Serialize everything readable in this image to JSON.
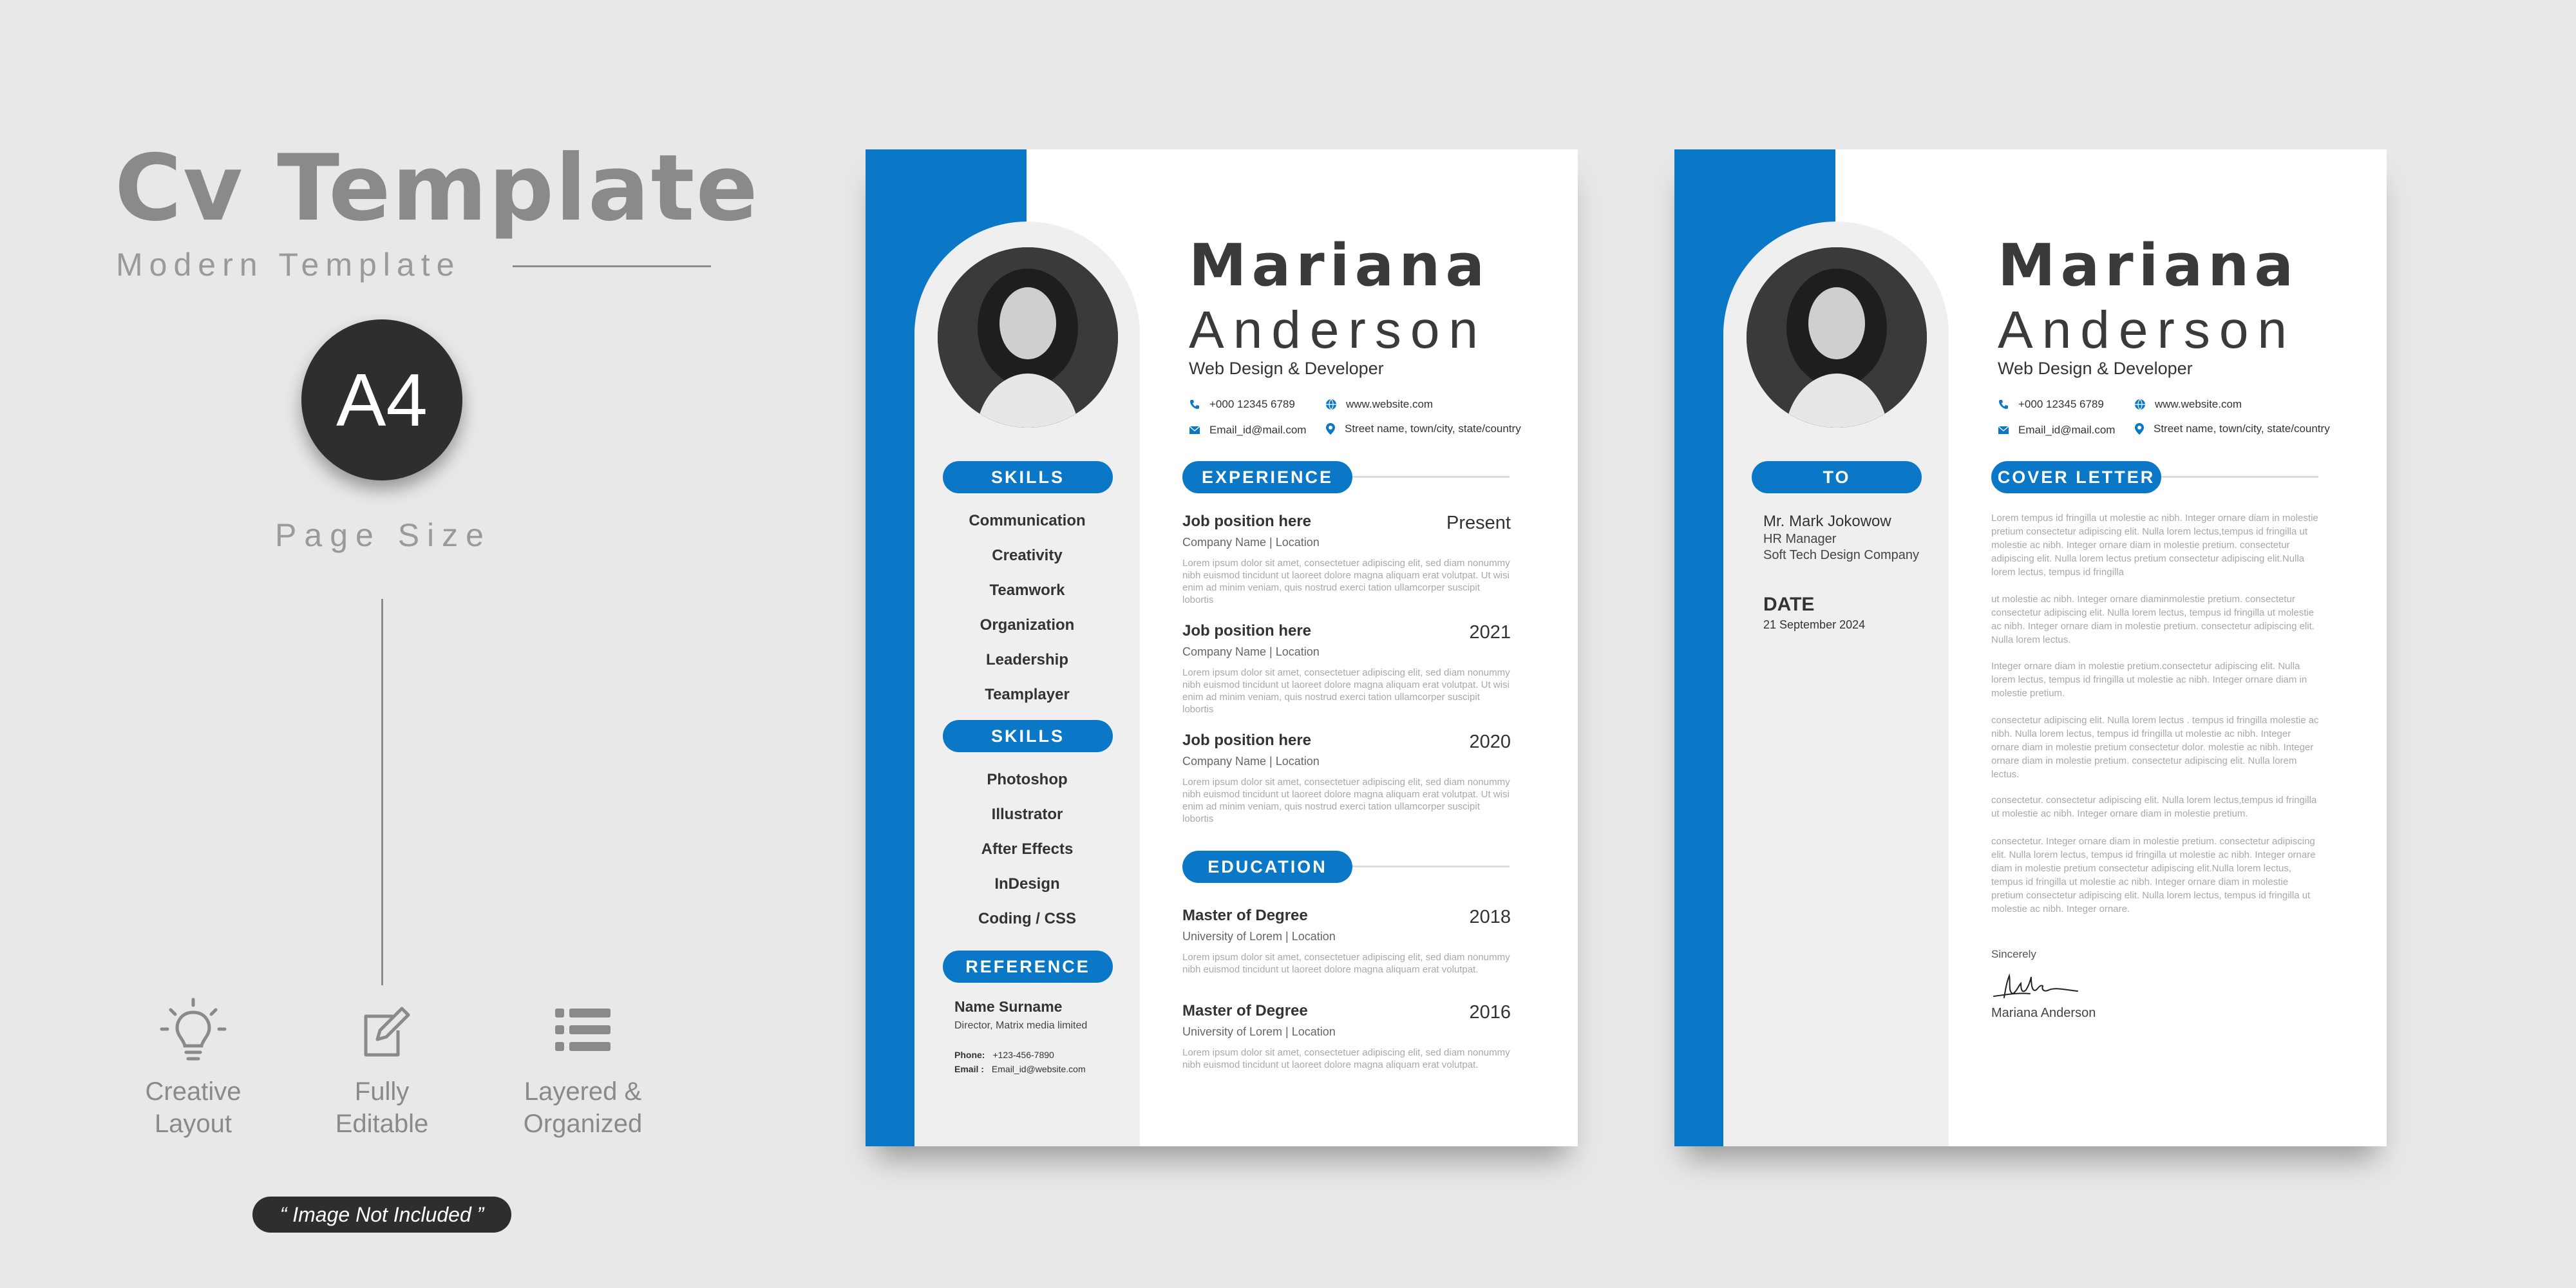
{
  "promo": {
    "title": "Cv Template",
    "subtitle": "Modern Template",
    "badge": "A4",
    "page_size": "Page Size",
    "features": [
      {
        "icon": "lightbulb-icon",
        "line1": "Creative",
        "line2": "Layout"
      },
      {
        "icon": "edit-icon",
        "line1": "Fully",
        "line2": "Editable"
      },
      {
        "icon": "layers-list-icon",
        "line1": "Layered &",
        "line2": "Organized"
      }
    ],
    "note": "“ Image Not Included ”"
  },
  "cv": {
    "first_name": "Mariana",
    "last_name": "Anderson",
    "role": "Web Design & Developer",
    "phone": "+000 12345 6789",
    "website": "www.website.com",
    "email": "Email_id@mail.com",
    "address": "Street name, town/city, state/country",
    "skills_label": "SKILLS",
    "skills": [
      "Communication",
      "Creativity",
      "Teamwork",
      "Organization",
      "Leadership",
      "Teamplayer"
    ],
    "skills2_label": "SKILLS",
    "software": [
      "Photoshop",
      "Illustrator",
      "After Effects",
      "InDesign",
      "Coding / CSS"
    ],
    "reference_label": "REFERENCE",
    "reference": {
      "name": "Name Surname",
      "role": "Director, Matrix media limited",
      "phone_label": "Phone:",
      "phone": "+123-456-7890",
      "email_label": "Email :",
      "email": "Email_id@website.com"
    },
    "experience_label": "EXPERIENCE",
    "experience": [
      {
        "title": "Job position here",
        "year": "Present",
        "company": "Company Name  |  Location",
        "desc": "Lorem ipsum dolor sit amet, consectetuer adipiscing elit, sed diam nonummy nibh euismod tincidunt ut laoreet dolore magna aliquam erat volutpat. Ut wisi enim ad minim veniam, quis nostrud exerci tation ullamcorper suscipit lobortis"
      },
      {
        "title": "Job position here",
        "year": "2021",
        "company": "Company Name  |  Location",
        "desc": "Lorem ipsum dolor sit amet, consectetuer adipiscing elit, sed diam nonummy nibh euismod tincidunt ut laoreet dolore magna aliquam erat volutpat. Ut wisi enim ad minim veniam, quis nostrud exerci tation ullamcorper suscipit lobortis"
      },
      {
        "title": "Job position here",
        "year": "2020",
        "company": "Company Name  |  Location",
        "desc": "Lorem ipsum dolor sit amet, consectetuer adipiscing elit, sed diam nonummy nibh euismod tincidunt ut laoreet dolore magna aliquam erat volutpat. Ut wisi enim ad minim veniam, quis nostrud exerci tation ullamcorper suscipit lobortis"
      }
    ],
    "education_label": "EDUCATION",
    "education": [
      {
        "title": "Master of Degree",
        "year": "2018",
        "company": "University of Lorem  |  Location",
        "desc": "Lorem ipsum dolor sit amet, consectetuer adipiscing elit, sed diam nonummy nibh euismod tincidunt ut laoreet dolore magna aliquam erat volutpat."
      },
      {
        "title": "Master of Degree",
        "year": "2016",
        "company": "University of Lorem  |  Location",
        "desc": "Lorem ipsum dolor sit amet, consectetuer adipiscing elit, sed diam nonummy nibh euismod tincidunt ut laoreet dolore magna aliquam erat volutpat."
      }
    ]
  },
  "cover": {
    "to_label": "TO",
    "to_name": "Mr. Mark Jokowow",
    "to_title": "HR Manager",
    "to_company": "Soft Tech Design Company",
    "date_label": "DATE",
    "date_value": "21 September 2024",
    "letter_label": "COVER LETTER",
    "paragraphs": [
      "Lorem tempus id fringilla ut molestie ac nibh. Integer ornare diam in molestie pretium consectetur adipiscing elit. Nulla lorem lectus,tempus id fringilla ut molestie ac nibh. Integer ornare diam in molestie pretium. consectetur adipiscing elit. Nulla lorem lectus pretium consectetur adipiscing elit.Nulla lorem lectus, tempus id fringilla",
      " ut molestie ac nibh. Integer ornare diaminmolestie pretium. consectetur consectetur adipiscing elit. Nulla lorem lectus, tempus id fringilla ut molestie ac nibh. Integer ornare diam in molestie   pretium.  consectetur adipiscing elit. Nulla lorem lectus.",
      "Integer ornare diam in molestie pretium.consectetur adipiscing elit. Nulla lorem lectus, tempus id fringilla ut molestie ac nibh. Integer ornare diam in molestie pretium.",
      "consectetur adipiscing elit. Nulla lorem lectus .  tempus id fringilla   molestie ac nibh. Nulla lorem lectus, tempus id fringilla ut molestie ac nibh. Integer ornare diam in molestie pretium consectetur dolor.   molestie ac nibh. Integer ornare diam in molestie  pretium. consectetur adipiscing elit. Nulla lorem lectus.",
      "consectetur. consectetur adipiscing elit. Nulla lorem lectus,tempus id fringilla ut molestie ac nibh. Integer ornare diam in molestie pretium.",
      "consectetur. Integer ornare diam in molestie pretium.  consectetur adipiscing elit. Nulla lorem lectus, tempus id fringilla ut molestie ac nibh. Integer ornare diam in molestie pretium consectetur adipiscing elit.Nulla lorem lectus, tempus id fringilla ut molestie ac nibh. Integer ornare diam in molestie pretium consectetur adipiscing elit. Nulla lorem lectus, tempus id fringilla ut molestie ac nibh. Integer ornare."
    ],
    "sincerely": "Sincerely",
    "sign_name": "Mariana Anderson"
  },
  "colors": {
    "accent": "#0a78c6",
    "dark": "#2e2e30",
    "grey_text": "#8a8a8c",
    "panel": "#efeff0"
  }
}
